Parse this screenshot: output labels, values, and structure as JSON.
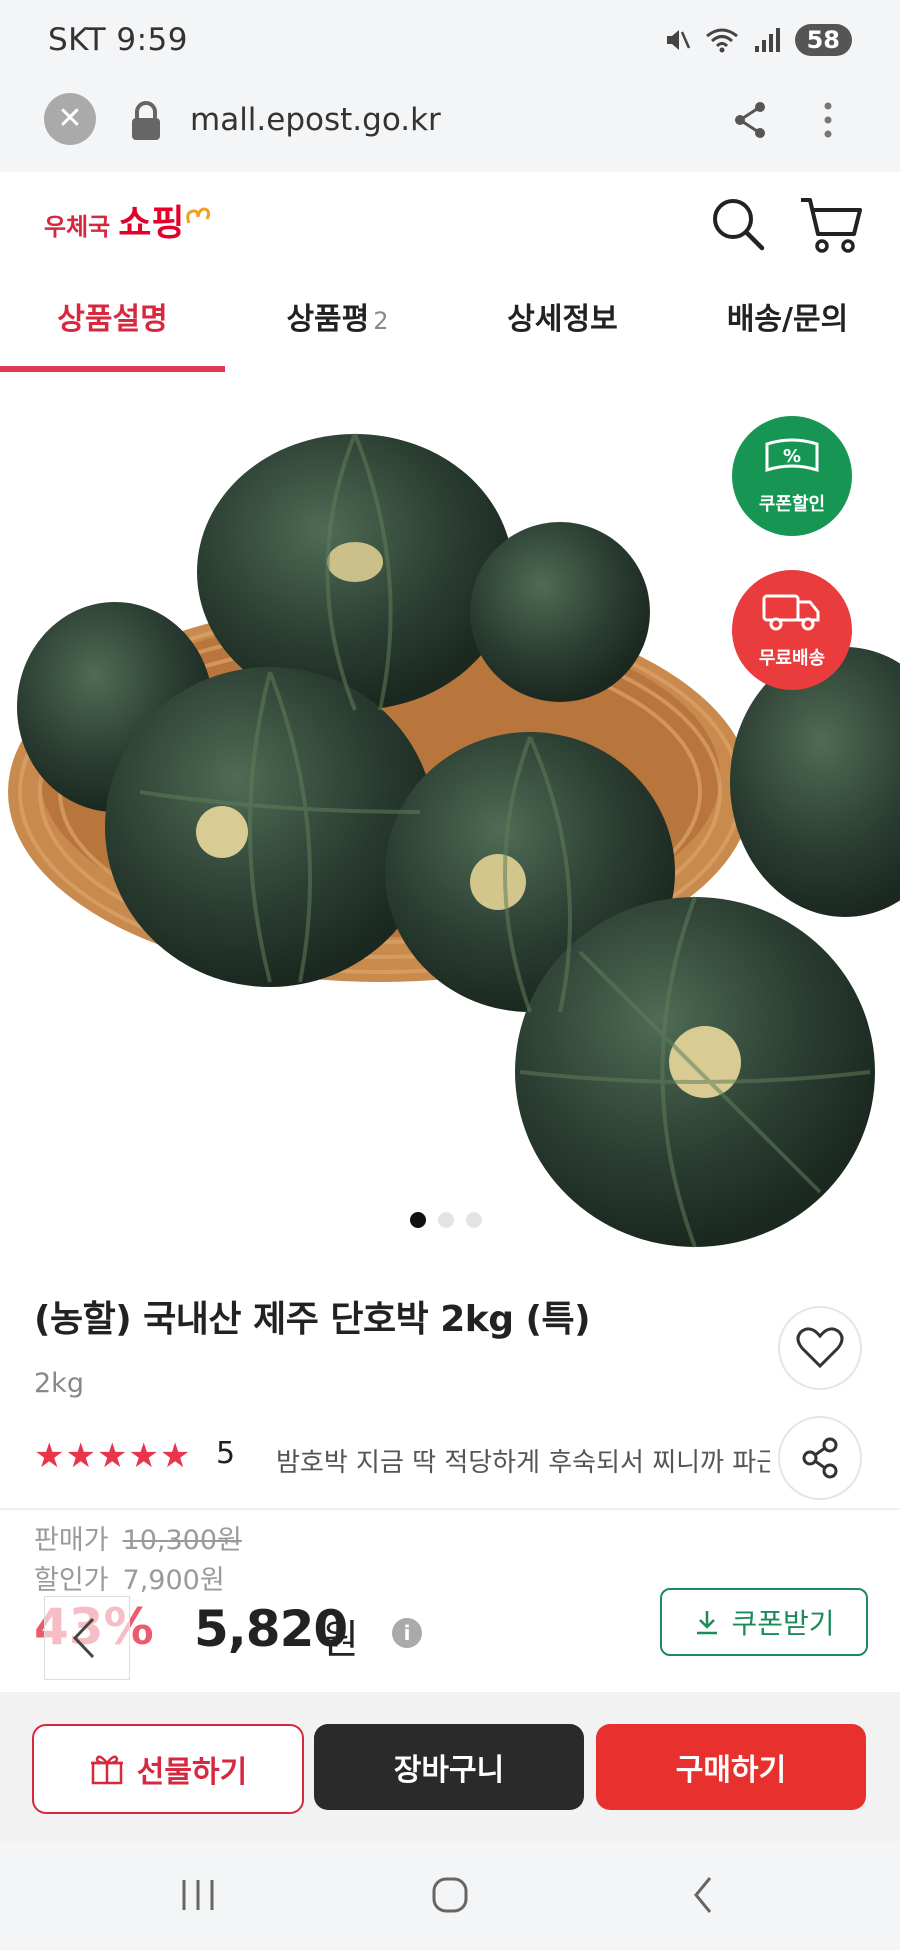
{
  "status": {
    "carrier_time": "SKT 9:59",
    "battery": "58"
  },
  "browser": {
    "url": "mall.epost.go.kr"
  },
  "header": {
    "logo_small": "우체국",
    "logo_big": "쇼핑"
  },
  "tabs": [
    {
      "label": "상품설명",
      "active": true
    },
    {
      "label": "상품평",
      "count": "2"
    },
    {
      "label": "상세정보"
    },
    {
      "label": "배송/문의"
    }
  ],
  "badges": {
    "coupon": "쿠폰할인",
    "shipping": "무료배송",
    "coupon_symbol": "%"
  },
  "product": {
    "title": "(농할) 국내산 제주 단호박 2kg (특)",
    "weight": "2kg",
    "rating": "5",
    "stars": "★★★★★",
    "review_snippet": "밤호박 지금 딱 적당하게 후숙되서 찌니까 파근하",
    "orig_label": "판매가",
    "orig_price": "10,300원",
    "disc_label": "할인가",
    "disc_price": "7,900원",
    "rate": "43%",
    "final_price": "5,820",
    "final_unit": "원",
    "coupon_btn": "쿠폰받기"
  },
  "actions": {
    "gift": "선물하기",
    "cart": "장바구니",
    "buy": "구매하기"
  },
  "colors": {
    "brand": "#e4002b",
    "tab_active": "#d6293f",
    "buy": "#e8302e",
    "coupon_green": "#1d8a5a"
  }
}
